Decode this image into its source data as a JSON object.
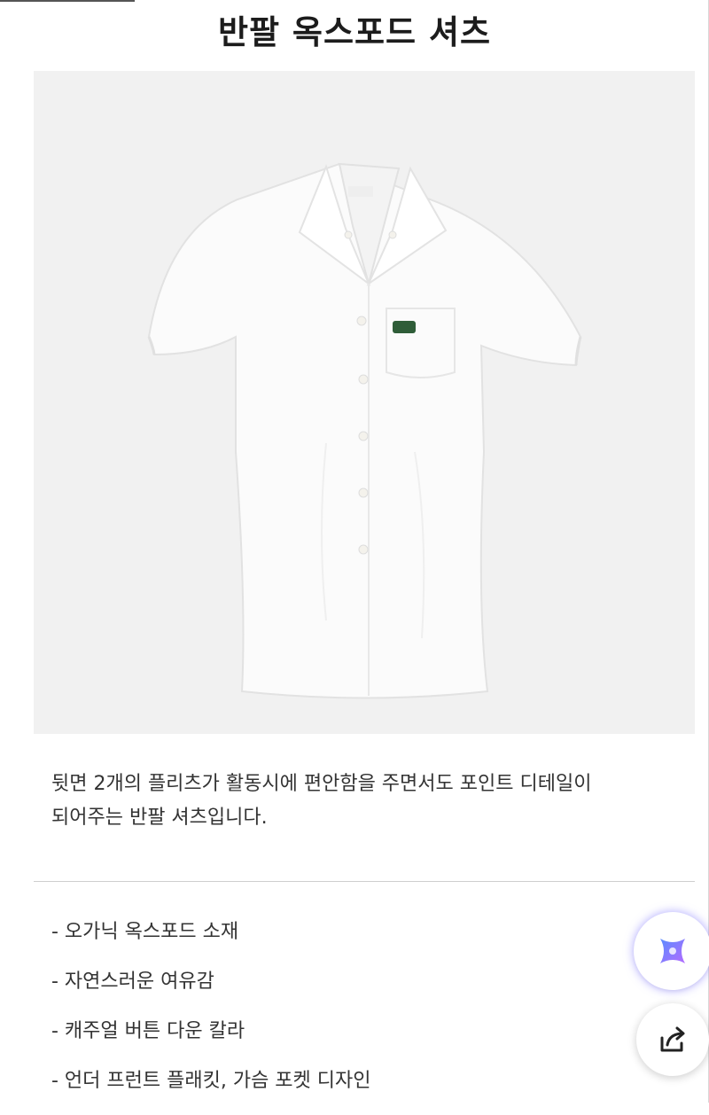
{
  "product": {
    "title": "반팔 옥스포드 셔츠",
    "image": {
      "subject": "shirt-image"
    }
  },
  "description": {
    "line1": "뒷면 2개의 플리츠가 활동시에 편안함을 주면서도 포인트 디테일이",
    "line2": "되어주는 반팔 셔츠입니다."
  },
  "features": [
    "- 오가닉 옥스포드 소재",
    "- 자연스러운 여유감",
    "- 캐주얼 버튼 다운 칼라",
    "- 언더 프런트 플래킷, 가슴 포켓 디자인"
  ],
  "floating_buttons": {
    "ai": {
      "icon": "sparkle-icon"
    },
    "share": {
      "icon": "share-icon"
    }
  },
  "colors": {
    "photo_bg": "#f1f1f1",
    "accent_ai_start": "#6a7dff",
    "accent_ai_end": "#b86bff"
  }
}
